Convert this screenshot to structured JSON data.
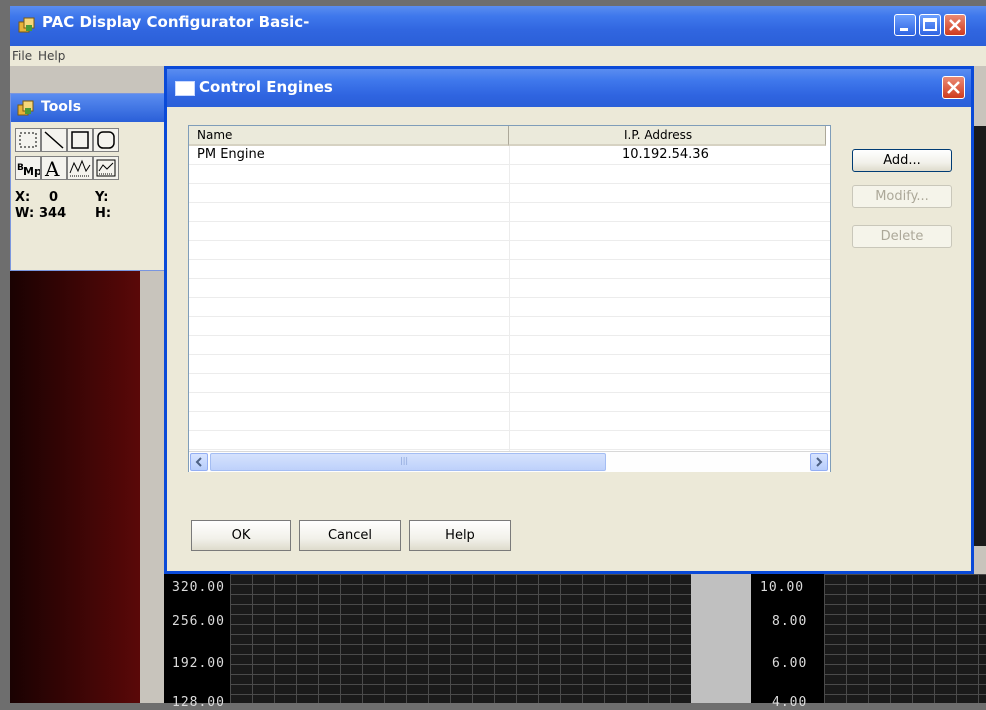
{
  "app": {
    "title": "PAC Display Configurator Basic-",
    "menu": [
      "File",
      "Help"
    ]
  },
  "tools_palette": {
    "title": "Tools",
    "tools_row1": [
      "select-marquee",
      "line",
      "rectangle",
      "rounded-rectangle"
    ],
    "tools_row2": [
      "bitmap",
      "text",
      "trend",
      "trend-config"
    ],
    "x_label": "X:",
    "x_value": "0",
    "y_label": "Y:",
    "w_label": "W:",
    "w_value": "344",
    "h_label": "H:"
  },
  "dialog": {
    "title": "Control Engines",
    "columns": [
      "Name",
      "I.P. Address"
    ],
    "rows": [
      {
        "name": "PM Engine",
        "ip": "10.192.54.36"
      }
    ],
    "buttons": {
      "add": "Add...",
      "modify": "Modify...",
      "delete": "Delete",
      "ok": "OK",
      "cancel": "Cancel",
      "help": "Help"
    },
    "scroll_thumb_glyph": "|||"
  },
  "scope": {
    "left_axis": [
      "320.00",
      "256.00",
      "192.00",
      "128.00"
    ],
    "right_axis": [
      "10.00",
      "8.00",
      "6.00",
      "4.00"
    ]
  },
  "colors": {
    "xp_blue": "#2a5fd8",
    "dialog_face": "#ece9d8",
    "close_red": "#cf3b1f"
  }
}
